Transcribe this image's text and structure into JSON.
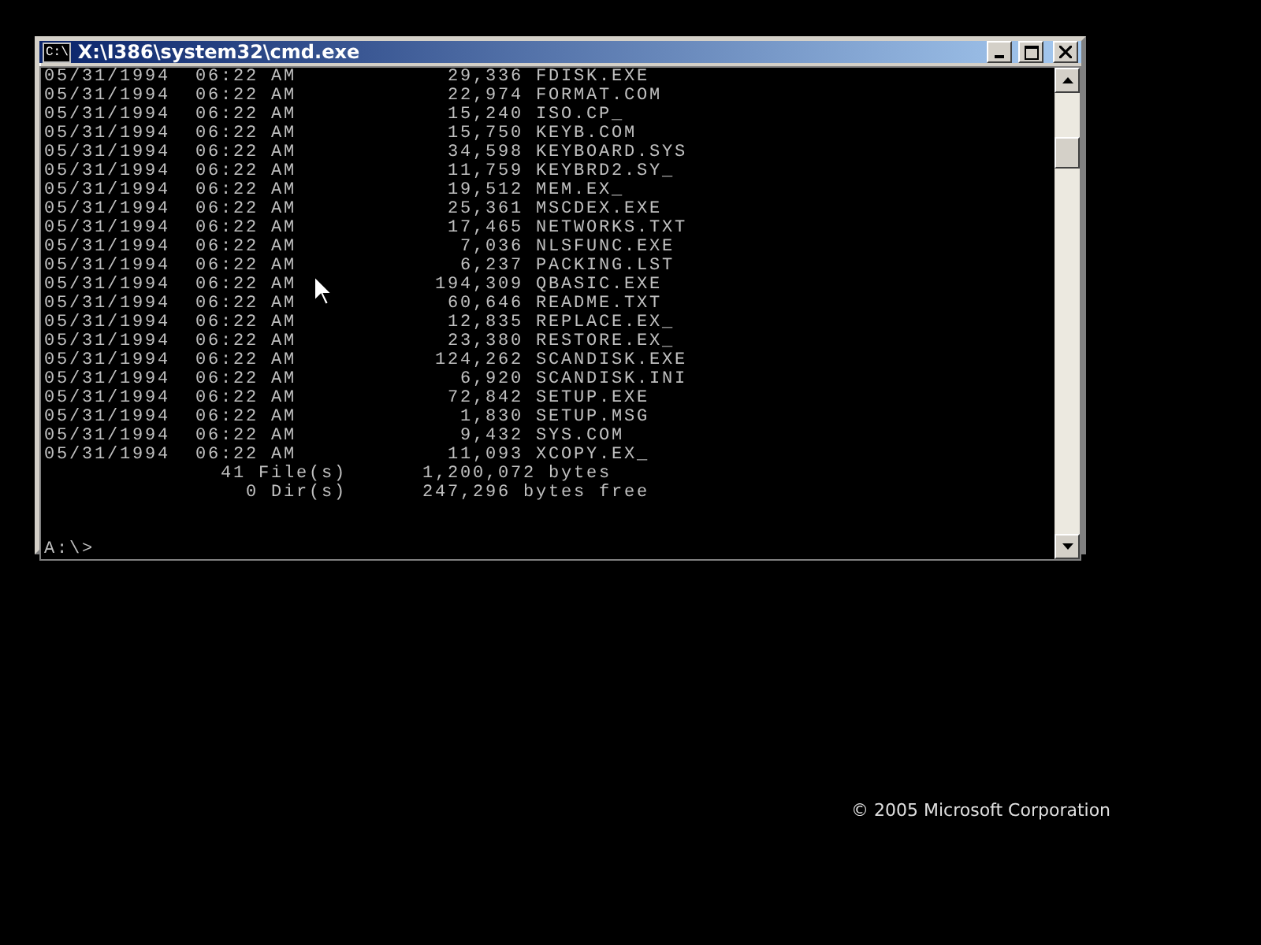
{
  "copyright": "© 2005 Microsoft Corporation",
  "window": {
    "title": "X:\\I386\\system32\\cmd.exe",
    "icon_text": "C:\\"
  },
  "console": {
    "files": [
      {
        "date": "05/31/1994",
        "time": "06:22 AM",
        "size": "29,336",
        "name": "FDISK.EXE"
      },
      {
        "date": "05/31/1994",
        "time": "06:22 AM",
        "size": "22,974",
        "name": "FORMAT.COM"
      },
      {
        "date": "05/31/1994",
        "time": "06:22 AM",
        "size": "15,240",
        "name": "ISO.CP_"
      },
      {
        "date": "05/31/1994",
        "time": "06:22 AM",
        "size": "15,750",
        "name": "KEYB.COM"
      },
      {
        "date": "05/31/1994",
        "time": "06:22 AM",
        "size": "34,598",
        "name": "KEYBOARD.SYS"
      },
      {
        "date": "05/31/1994",
        "time": "06:22 AM",
        "size": "11,759",
        "name": "KEYBRD2.SY_"
      },
      {
        "date": "05/31/1994",
        "time": "06:22 AM",
        "size": "19,512",
        "name": "MEM.EX_"
      },
      {
        "date": "05/31/1994",
        "time": "06:22 AM",
        "size": "25,361",
        "name": "MSCDEX.EXE"
      },
      {
        "date": "05/31/1994",
        "time": "06:22 AM",
        "size": "17,465",
        "name": "NETWORKS.TXT"
      },
      {
        "date": "05/31/1994",
        "time": "06:22 AM",
        "size": "7,036",
        "name": "NLSFUNC.EXE"
      },
      {
        "date": "05/31/1994",
        "time": "06:22 AM",
        "size": "6,237",
        "name": "PACKING.LST"
      },
      {
        "date": "05/31/1994",
        "time": "06:22 AM",
        "size": "194,309",
        "name": "QBASIC.EXE"
      },
      {
        "date": "05/31/1994",
        "time": "06:22 AM",
        "size": "60,646",
        "name": "README.TXT"
      },
      {
        "date": "05/31/1994",
        "time": "06:22 AM",
        "size": "12,835",
        "name": "REPLACE.EX_"
      },
      {
        "date": "05/31/1994",
        "time": "06:22 AM",
        "size": "23,380",
        "name": "RESTORE.EX_"
      },
      {
        "date": "05/31/1994",
        "time": "06:22 AM",
        "size": "124,262",
        "name": "SCANDISK.EXE"
      },
      {
        "date": "05/31/1994",
        "time": "06:22 AM",
        "size": "6,920",
        "name": "SCANDISK.INI"
      },
      {
        "date": "05/31/1994",
        "time": "06:22 AM",
        "size": "72,842",
        "name": "SETUP.EXE"
      },
      {
        "date": "05/31/1994",
        "time": "06:22 AM",
        "size": "1,830",
        "name": "SETUP.MSG"
      },
      {
        "date": "05/31/1994",
        "time": "06:22 AM",
        "size": "9,432",
        "name": "SYS.COM"
      },
      {
        "date": "05/31/1994",
        "time": "06:22 AM",
        "size": "11,093",
        "name": "XCOPY.EX_"
      }
    ],
    "summary": [
      {
        "count": "41 File(s)",
        "bytes": "1,200,072 bytes"
      },
      {
        "count": "0 Dir(s)",
        "bytes": "247,296 bytes free"
      }
    ],
    "prompt": "A:\\>"
  }
}
